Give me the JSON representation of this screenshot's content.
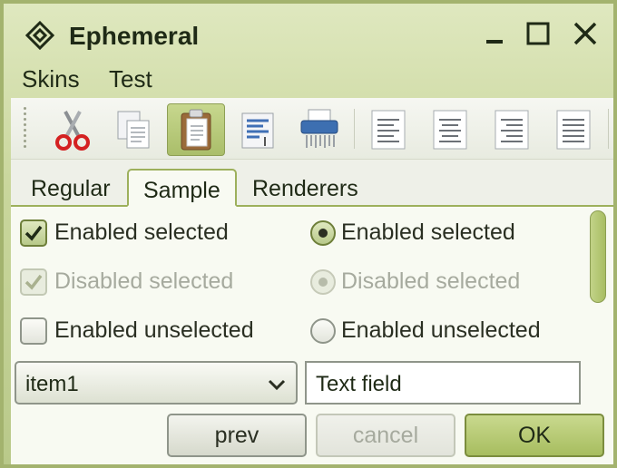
{
  "window": {
    "title": "Ephemeral"
  },
  "menu": {
    "items": [
      "Skins",
      "Test"
    ]
  },
  "toolbar": {
    "buttons": [
      {
        "icon": "cut-icon"
      },
      {
        "icon": "copy-icon"
      },
      {
        "icon": "paste-icon",
        "selected": true
      },
      {
        "icon": "find-icon"
      },
      {
        "icon": "shredder-icon"
      },
      {
        "icon": "align-left-icon"
      },
      {
        "icon": "align-center-icon"
      },
      {
        "icon": "align-right-icon"
      },
      {
        "icon": "align-justify-icon"
      }
    ]
  },
  "tabs": {
    "items": [
      "Regular",
      "Sample",
      "Renderers"
    ],
    "selected": "Sample"
  },
  "checkboxes": {
    "enabled_selected": "Enabled selected",
    "disabled_selected": "Disabled selected",
    "enabled_unselected": "Enabled unselected"
  },
  "radios": {
    "enabled_selected": "Enabled selected",
    "disabled_selected": "Disabled selected",
    "enabled_unselected": "Enabled unselected"
  },
  "combo": {
    "value": "item1"
  },
  "textfield": {
    "value": "Text field"
  },
  "buttons": {
    "prev": "prev",
    "cancel": "cancel",
    "ok": "OK"
  },
  "colors": {
    "accent": "#a7bd5f",
    "frame": "#a3b36e"
  }
}
